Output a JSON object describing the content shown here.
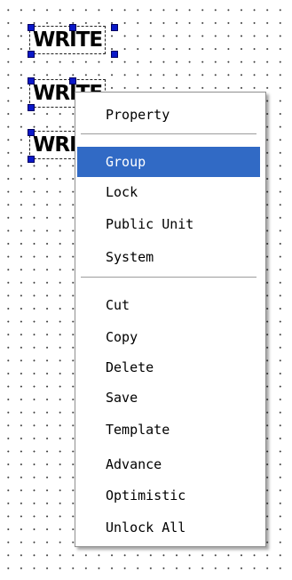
{
  "canvas": {
    "parts": [
      {
        "label": "WRITE"
      },
      {
        "label": "WRITE"
      },
      {
        "label": "WRITE"
      }
    ]
  },
  "context_menu": {
    "items": [
      {
        "label": "Property"
      },
      {
        "label": "Group",
        "highlighted": true
      },
      {
        "label": "Lock"
      },
      {
        "label": "Public Unit"
      },
      {
        "label": "System"
      },
      {
        "label": "Cut"
      },
      {
        "label": "Copy"
      },
      {
        "label": "Delete"
      },
      {
        "label": "Save"
      },
      {
        "label": "Template"
      },
      {
        "label": "Advance"
      },
      {
        "label": "Optimistic"
      },
      {
        "label": "Unlock All"
      }
    ],
    "highlight_color": "#316ac5"
  }
}
